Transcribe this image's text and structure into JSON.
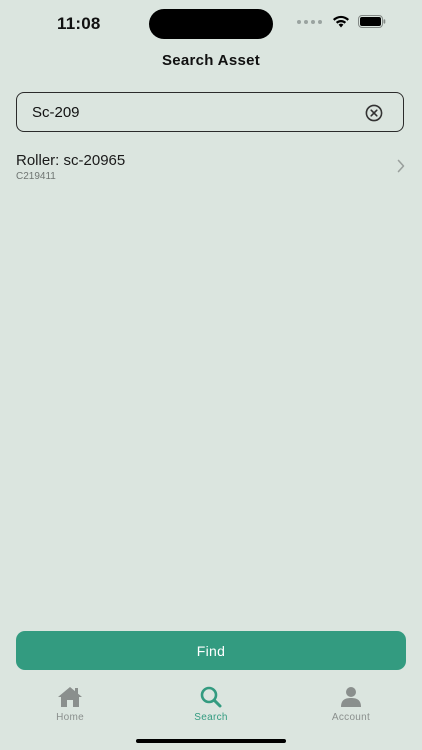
{
  "status_bar": {
    "time": "11:08"
  },
  "header": {
    "title": "Search Asset"
  },
  "search": {
    "value": "Sc-209"
  },
  "results": [
    {
      "title": "Roller: sc-20965",
      "subtitle": "C219411"
    }
  ],
  "actions": {
    "find_label": "Find"
  },
  "tab_bar": {
    "tabs": [
      {
        "label": "Home",
        "icon": "house-icon",
        "active": false
      },
      {
        "label": "Search",
        "icon": "magnifier-icon",
        "active": true
      },
      {
        "label": "Account",
        "icon": "person-icon",
        "active": false
      }
    ]
  },
  "colors": {
    "background": "#dbe5df",
    "accent": "#339b80",
    "inactive_tab": "#8a8f8d"
  }
}
